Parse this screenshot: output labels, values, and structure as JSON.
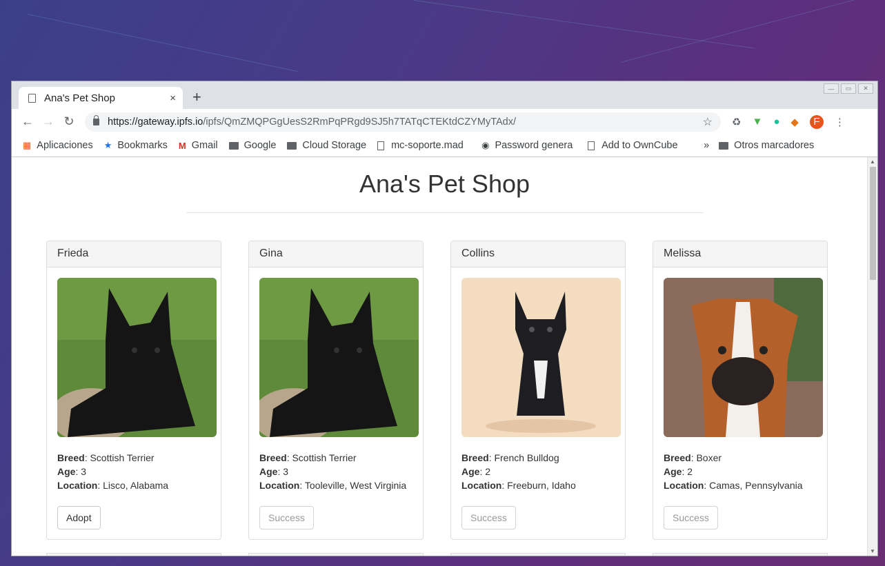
{
  "browser": {
    "tab_title": "Ana's Pet Shop",
    "tab_close": "×",
    "new_tab": "+",
    "url_host": "https://gateway.ipfs.io",
    "url_path": "/ipfs/QmZMQPGgUesS2RmPqPRgd9SJ5h7TATqCTEKtdCZYMyTAdx/",
    "avatar_letter": "F",
    "bookmarks": [
      {
        "label": "Aplicaciones",
        "icon": "apps-grid-icon"
      },
      {
        "label": "Bookmarks",
        "icon": "star-icon"
      },
      {
        "label": "Gmail",
        "icon": "gmail-icon"
      },
      {
        "label": "Google",
        "icon": "folder-icon"
      },
      {
        "label": "Cloud Storage",
        "icon": "folder-icon"
      },
      {
        "label": "mc-soporte.mad",
        "icon": "file-icon"
      },
      {
        "label": "Password genera",
        "icon": "password-icon"
      },
      {
        "label": "Add to OwnCube",
        "icon": "file-icon"
      }
    ],
    "bookmarks_overflow": "»",
    "other_bookmarks": "Otros marcadores"
  },
  "page": {
    "title": "Ana's Pet Shop",
    "labels": {
      "breed": "Breed",
      "age": "Age",
      "location": "Location"
    },
    "pets": [
      {
        "name": "Frieda",
        "breed": "Scottish Terrier",
        "age": "3",
        "location": "Lisco, Alabama",
        "button": "Adopt",
        "photo": "scottish-terrier-photo"
      },
      {
        "name": "Gina",
        "breed": "Scottish Terrier",
        "age": "3",
        "location": "Tooleville, West Virginia",
        "button": "Success",
        "photo": "scottish-terrier-photo"
      },
      {
        "name": "Collins",
        "breed": "French Bulldog",
        "age": "2",
        "location": "Freeburn, Idaho",
        "button": "Success",
        "photo": "french-bulldog-photo"
      },
      {
        "name": "Melissa",
        "breed": "Boxer",
        "age": "2",
        "location": "Camas, Pennsylvania",
        "button": "Success",
        "photo": "boxer-photo"
      }
    ]
  },
  "colors": {
    "accent_avatar": "#e8541c",
    "card_header_bg": "#f5f5f5"
  }
}
